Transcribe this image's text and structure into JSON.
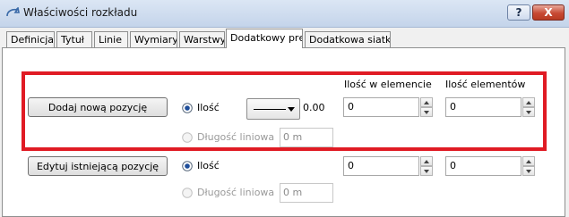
{
  "window": {
    "title": "Właściwości rozkładu",
    "help_label": "?",
    "close_label": "X"
  },
  "tabs": [
    {
      "label": "Definicja",
      "active": false
    },
    {
      "label": "Tytuł",
      "active": false
    },
    {
      "label": "Linie",
      "active": false
    },
    {
      "label": "Wymiary",
      "active": false
    },
    {
      "label": "Warstwy",
      "active": false
    },
    {
      "label": "Dodatkowy pręt",
      "active": true
    },
    {
      "label": "Dodatkowa siatka",
      "active": false
    }
  ],
  "columns": {
    "qty_in_element": "Ilość w elemencie",
    "element_count": "Ilość elementów"
  },
  "row1": {
    "button": "Dodaj nową pozycję",
    "radio_qty": "Ilość",
    "radio_qty_selected": true,
    "line_style_value": "0.00",
    "radio_length": "Długość liniowa",
    "length_value": "0 m",
    "qty_in_element": "0",
    "element_count": "0"
  },
  "row2": {
    "button": "Edytuj istniejącą pozycję",
    "radio_qty": "Ilość",
    "radio_qty_selected": true,
    "radio_length": "Długość liniowa",
    "length_value": "0 m",
    "qty_in_element": "0",
    "element_count": "0"
  },
  "colors": {
    "highlight": "#e01b24",
    "radio_fill": "#1f4e9a"
  },
  "icons": {
    "app": "schedule-app-icon",
    "combo": "chevron-down-icon",
    "spin_up": "spin-up-icon",
    "spin_down": "spin-down-icon"
  }
}
